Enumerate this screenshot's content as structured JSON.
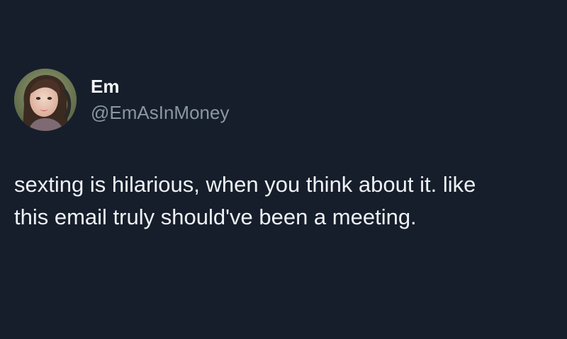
{
  "tweet": {
    "author": {
      "name": "Em",
      "handle": "@EmAsInMoney",
      "avatar_icon": "profile-photo"
    },
    "text_lines": [
      "sexting is hilarious, when you think about it. like",
      "this email truly should've been a meeting."
    ]
  },
  "colors": {
    "background": "#161e2b",
    "name": "#f3f5f7",
    "handle": "#8a96a3",
    "text": "#eef1f4"
  }
}
